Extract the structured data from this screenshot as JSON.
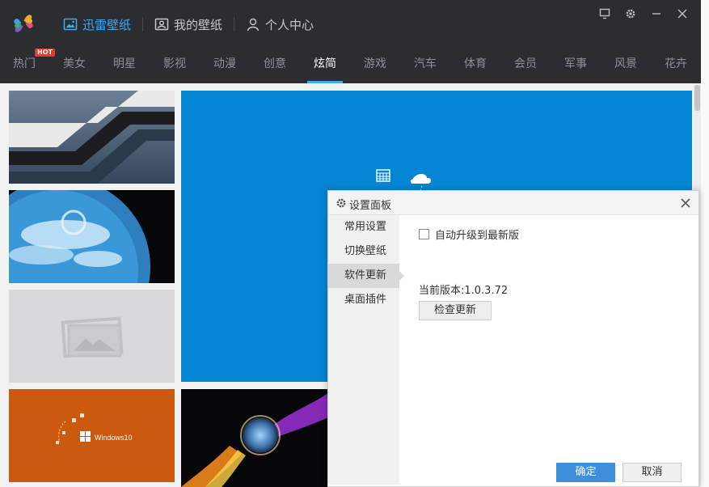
{
  "header": {
    "nav": [
      {
        "label": "迅雷壁纸",
        "icon": "image-icon",
        "active": true
      },
      {
        "label": "我的壁纸",
        "icon": "user-image-icon",
        "active": false
      },
      {
        "label": "个人中心",
        "icon": "person-icon",
        "active": false
      }
    ],
    "window_controls": [
      "skin-icon",
      "gear-icon",
      "minimize-icon",
      "close-icon"
    ]
  },
  "categories": {
    "items": [
      "热门",
      "美女",
      "明星",
      "影视",
      "动漫",
      "创意",
      "炫简",
      "游戏",
      "汽车",
      "体育",
      "会员",
      "军事",
      "风景",
      "花卉"
    ],
    "active": "炫简",
    "hot_badge": "HOT"
  },
  "wallpapers": {
    "windows_label": "Windows10"
  },
  "dialog": {
    "title": "设置面板",
    "sidebar": [
      "常用设置",
      "切换壁纸",
      "软件更新",
      "桌面插件"
    ],
    "active": "软件更新",
    "auto_upgrade_label": "自动升级到最新版",
    "auto_upgrade_checked": false,
    "version_text": "当前版本:1.0.3.72",
    "check_update_label": "检查更新",
    "ok_label": "确定",
    "cancel_label": "取消"
  },
  "colors": {
    "accent": "#3ea9f5",
    "header_bg": "#2b2d31",
    "ok_button": "#3d8fdb",
    "hot_badge": "#e53935"
  }
}
